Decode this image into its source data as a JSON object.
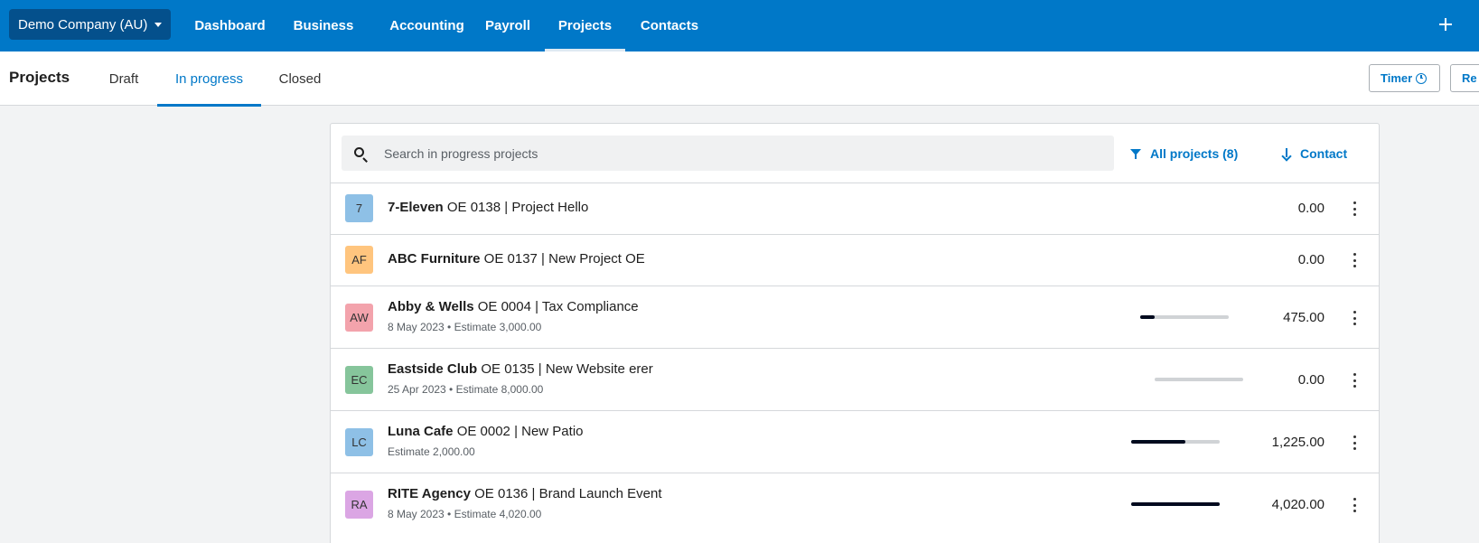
{
  "topnav": {
    "org": "Demo Company (AU)",
    "items": [
      "Dashboard",
      "Business",
      "Accounting",
      "Payroll",
      "Projects",
      "Contacts"
    ],
    "active": "Projects"
  },
  "subheader": {
    "title": "Projects",
    "tabs": [
      "Draft",
      "In progress",
      "Closed"
    ],
    "active_tab": "In progress",
    "timer_label": "Timer",
    "second_button_label": "Re"
  },
  "toolbar": {
    "search_placeholder": "Search in progress projects",
    "filter_label": "All projects (8)",
    "sort_label": "Contact"
  },
  "projects": [
    {
      "initials": "7",
      "color": "#8ec0e6",
      "contact": "7-Eleven",
      "detail": "OE 0138 | Project Hello",
      "sub": "",
      "amount": "0.00",
      "progress": null
    },
    {
      "initials": "AF",
      "color": "#ffc57e",
      "contact": "ABC Furniture",
      "detail": "OE 0137 | New Project OE",
      "sub": "",
      "amount": "0.00",
      "progress": null
    },
    {
      "initials": "AW",
      "color": "#f3a3ac",
      "contact": "Abby & Wells",
      "detail": "OE 0004 | Tax Compliance",
      "sub": "8 May 2023 • Estimate 3,000.00",
      "amount": "475.00",
      "progress": 0.16
    },
    {
      "initials": "EC",
      "color": "#86c59b",
      "contact": "Eastside Club",
      "detail": "OE 0135 | New Website erer",
      "sub": "25 Apr 2023 • Estimate 8,000.00",
      "amount": "0.00",
      "progress": 0.0
    },
    {
      "initials": "LC",
      "color": "#8ec0e6",
      "contact": "Luna Cafe",
      "detail": "OE 0002 | New Patio",
      "sub": "Estimate 2,000.00",
      "amount": "1,225.00",
      "progress": 0.61
    },
    {
      "initials": "RA",
      "color": "#dba6e4",
      "contact": "RITE Agency",
      "detail": "OE 0136 | Brand Launch Event",
      "sub": "8 May 2023 • Estimate 4,020.00",
      "amount": "4,020.00",
      "progress": 1.0
    }
  ]
}
